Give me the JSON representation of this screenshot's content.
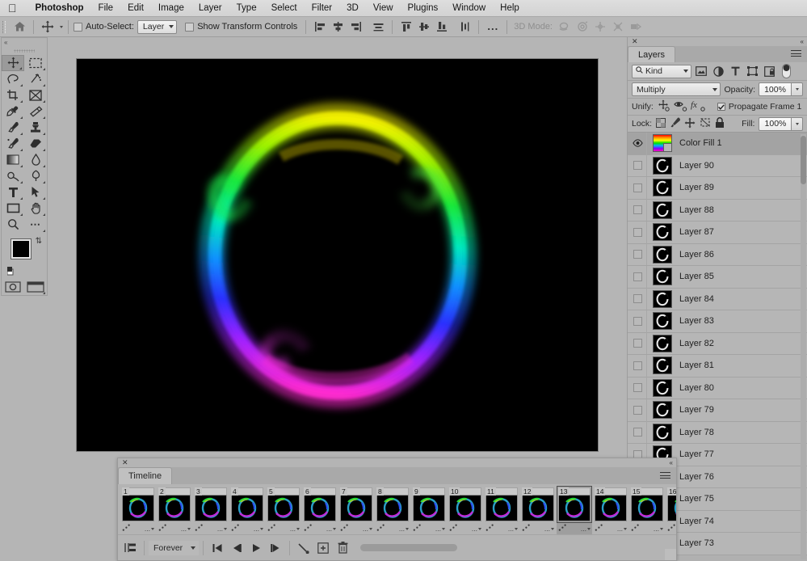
{
  "menubar": {
    "apple": "",
    "items": [
      {
        "label": "Photoshop",
        "brand": true
      },
      {
        "label": "File"
      },
      {
        "label": "Edit"
      },
      {
        "label": "Image"
      },
      {
        "label": "Layer"
      },
      {
        "label": "Type"
      },
      {
        "label": "Select"
      },
      {
        "label": "Filter"
      },
      {
        "label": "3D"
      },
      {
        "label": "View"
      },
      {
        "label": "Plugins"
      },
      {
        "label": "Window"
      },
      {
        "label": "Help"
      }
    ]
  },
  "options_bar": {
    "home_icon": "home-icon",
    "tool_icon": "move-tool-icon",
    "auto_select_label": "Auto-Select:",
    "auto_select_checked": false,
    "auto_select_scope": "Layer",
    "show_transform_label": "Show Transform Controls",
    "show_transform_checked": false,
    "align_icons": [
      "align-left-edges",
      "align-horizontal-centers",
      "align-right-edges",
      "distribute-horizontally"
    ],
    "distribute_icons": [
      "align-top-edges",
      "align-vertical-centers",
      "align-bottom-edges",
      "distribute-vertically"
    ],
    "more_label": "...",
    "three_d_mode_label": "3D Mode:",
    "three_d_icons": [
      "rotate-3d-icon",
      "roll-3d-icon",
      "drag-3d-icon",
      "slide-3d-icon",
      "scale-3d-icon"
    ]
  },
  "toolbar": {
    "tools": [
      {
        "name": "move-tool",
        "active": true
      },
      {
        "name": "rectangular-marquee-tool",
        "active": false
      },
      {
        "name": "lasso-tool",
        "active": false
      },
      {
        "name": "object-selection-tool",
        "active": false
      },
      {
        "name": "crop-tool",
        "active": false
      },
      {
        "name": "frame-tool",
        "active": false
      },
      {
        "name": "eyedropper-tool",
        "active": false
      },
      {
        "name": "healing-brush-tool",
        "active": false
      },
      {
        "name": "brush-tool",
        "active": false
      },
      {
        "name": "clone-stamp-tool",
        "active": false
      },
      {
        "name": "history-brush-tool",
        "active": false
      },
      {
        "name": "eraser-tool",
        "active": false
      },
      {
        "name": "gradient-tool",
        "active": false
      },
      {
        "name": "blur-tool",
        "active": false
      },
      {
        "name": "dodge-tool",
        "active": false
      },
      {
        "name": "pen-tool",
        "active": false
      },
      {
        "name": "type-tool",
        "active": false
      },
      {
        "name": "path-selection-tool",
        "active": false
      },
      {
        "name": "rectangle-tool",
        "active": false
      },
      {
        "name": "hand-tool",
        "active": false
      },
      {
        "name": "zoom-tool",
        "active": false
      },
      {
        "name": "edit-toolbar-tool",
        "active": false
      }
    ],
    "foreground_color": "#000000",
    "background_color": "#ffffff",
    "quick_mask_icon": "quick-mask-icon",
    "screen_mode_icon": "screen-mode-icon"
  },
  "canvas": {
    "document_title": "",
    "artwork_description": "rainbow smoke ring on black background"
  },
  "layers_panel": {
    "tab_label": "Layers",
    "filter_kind_label": "Kind",
    "filter_icons": [
      "pixel-layer-filter-icon",
      "adjustment-layer-filter-icon",
      "type-layer-filter-icon",
      "shape-layer-filter-icon",
      "smart-object-filter-icon"
    ],
    "filter_toggle": "filter-enable-toggle",
    "blend_mode": "Multiply",
    "opacity_label": "Opacity:",
    "opacity_value": "100%",
    "unify_label": "Unify:",
    "unify_icons": [
      "unify-position-icon",
      "unify-visibility-icon",
      "unify-style-icon"
    ],
    "propagate_label": "Propagate Frame 1",
    "propagate_checked": true,
    "lock_label": "Lock:",
    "lock_icons": [
      "lock-transparent-pixels-icon",
      "lock-image-pixels-icon",
      "lock-position-icon",
      "lock-artboard-nesting-icon",
      "lock-all-icon"
    ],
    "fill_label": "Fill:",
    "fill_value": "100%",
    "layers": [
      {
        "name": "Color Fill 1",
        "visible": true,
        "selected": true,
        "type": "color-fill"
      },
      {
        "name": "Layer 90",
        "visible": false,
        "selected": false,
        "type": "pixel"
      },
      {
        "name": "Layer 89",
        "visible": false,
        "selected": false,
        "type": "pixel"
      },
      {
        "name": "Layer 88",
        "visible": false,
        "selected": false,
        "type": "pixel"
      },
      {
        "name": "Layer 87",
        "visible": false,
        "selected": false,
        "type": "pixel"
      },
      {
        "name": "Layer 86",
        "visible": false,
        "selected": false,
        "type": "pixel"
      },
      {
        "name": "Layer 85",
        "visible": false,
        "selected": false,
        "type": "pixel"
      },
      {
        "name": "Layer 84",
        "visible": false,
        "selected": false,
        "type": "pixel"
      },
      {
        "name": "Layer 83",
        "visible": false,
        "selected": false,
        "type": "pixel"
      },
      {
        "name": "Layer 82",
        "visible": false,
        "selected": false,
        "type": "pixel"
      },
      {
        "name": "Layer 81",
        "visible": false,
        "selected": false,
        "type": "pixel"
      },
      {
        "name": "Layer 80",
        "visible": false,
        "selected": false,
        "type": "pixel"
      },
      {
        "name": "Layer 79",
        "visible": false,
        "selected": false,
        "type": "pixel"
      },
      {
        "name": "Layer 78",
        "visible": false,
        "selected": false,
        "type": "pixel"
      },
      {
        "name": "Layer 77",
        "visible": false,
        "selected": false,
        "type": "pixel"
      },
      {
        "name": "Layer 76",
        "visible": false,
        "selected": false,
        "type": "pixel"
      },
      {
        "name": "Layer 75",
        "visible": false,
        "selected": false,
        "type": "pixel"
      },
      {
        "name": "Layer 74",
        "visible": false,
        "selected": false,
        "type": "pixel"
      },
      {
        "name": "Layer 73",
        "visible": false,
        "selected": false,
        "type": "pixel"
      }
    ]
  },
  "timeline_panel": {
    "tab_label": "Timeline",
    "frames": [
      {
        "number": "1",
        "selected": false
      },
      {
        "number": "2",
        "selected": false
      },
      {
        "number": "3",
        "selected": false
      },
      {
        "number": "4",
        "selected": false
      },
      {
        "number": "5",
        "selected": false
      },
      {
        "number": "6",
        "selected": false
      },
      {
        "number": "7",
        "selected": false
      },
      {
        "number": "8",
        "selected": false
      },
      {
        "number": "9",
        "selected": false
      },
      {
        "number": "10",
        "selected": false
      },
      {
        "number": "11",
        "selected": false
      },
      {
        "number": "12",
        "selected": false
      },
      {
        "number": "13",
        "selected": true
      },
      {
        "number": "14",
        "selected": false
      },
      {
        "number": "15",
        "selected": false
      },
      {
        "number": "16",
        "selected": false
      }
    ],
    "frame_delay_label": "...",
    "loop_option": "Forever",
    "controls": [
      {
        "name": "convert-to-video-timeline-button"
      },
      {
        "name": "select-first-frame-button"
      },
      {
        "name": "select-previous-frame-button"
      },
      {
        "name": "play-animation-button"
      },
      {
        "name": "select-next-frame-button"
      },
      {
        "name": "tween-frames-button"
      },
      {
        "name": "duplicate-frame-button"
      },
      {
        "name": "delete-frame-button"
      }
    ]
  },
  "colors": {
    "chrome_bg": "#b4b4b4",
    "menu_bg": "#d6d6d6",
    "selected_row": "#a3a3a3",
    "canvas_black": "#000000"
  }
}
